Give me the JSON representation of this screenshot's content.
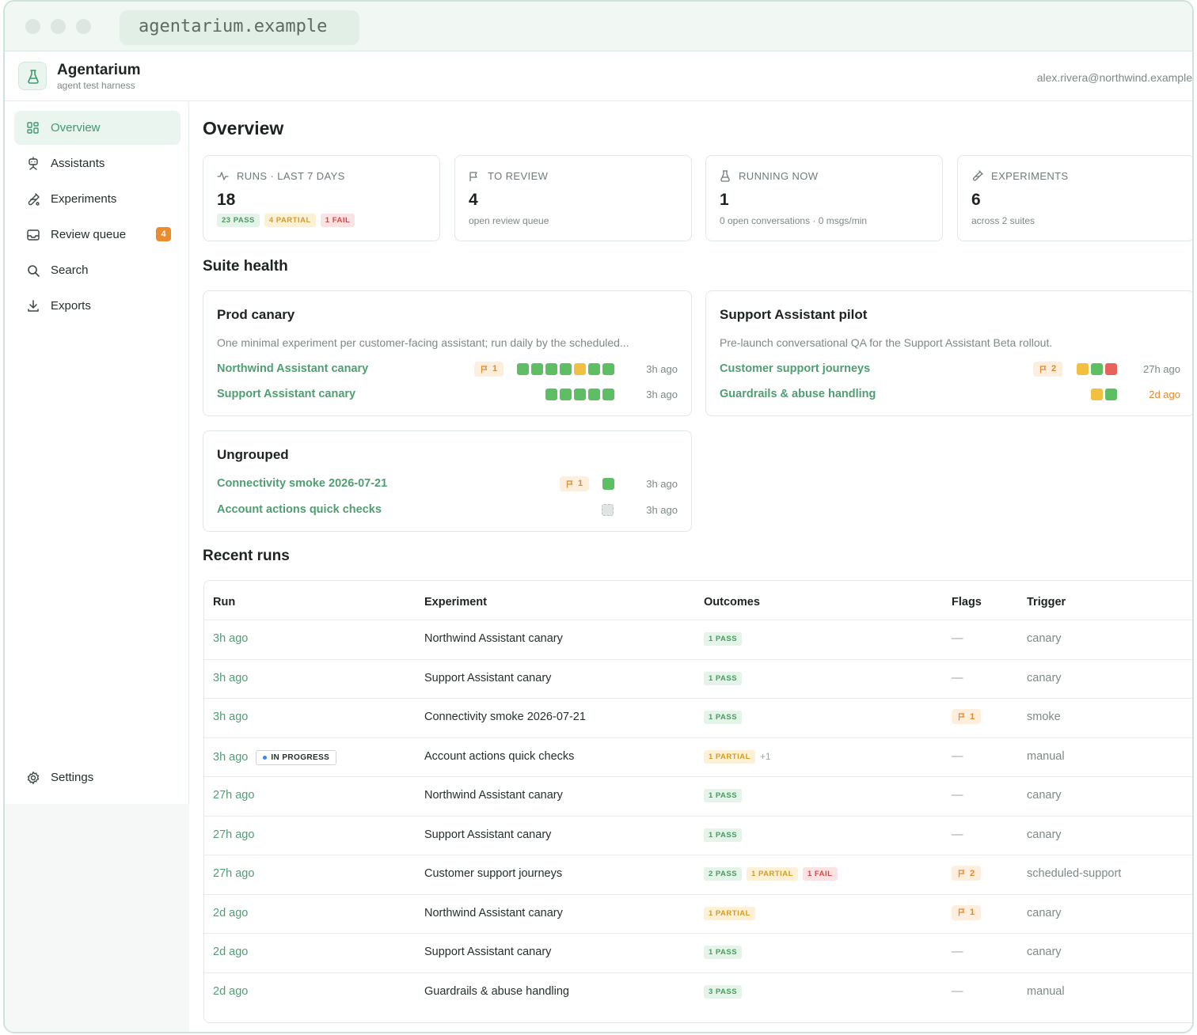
{
  "browser": {
    "url": "agentarium.example"
  },
  "app": {
    "name": "Agentarium",
    "subtitle": "agent test harness",
    "user_email": "alex.rivera@northwind.example"
  },
  "nav": {
    "items": [
      {
        "label": "Overview",
        "icon": "dashboard-icon",
        "active": true
      },
      {
        "label": "Assistants",
        "icon": "robot-icon"
      },
      {
        "label": "Experiments",
        "icon": "flask-icon"
      },
      {
        "label": "Review queue",
        "icon": "inbox-icon",
        "badge": "4"
      },
      {
        "label": "Search",
        "icon": "search-icon"
      },
      {
        "label": "Exports",
        "icon": "download-icon"
      }
    ],
    "settings": {
      "label": "Settings",
      "icon": "gear-icon"
    }
  },
  "page": {
    "title": "Overview"
  },
  "stats": {
    "runs": {
      "label": "RUNS · LAST 7 DAYS",
      "value": "18",
      "pass": "23 PASS",
      "partial": "4 PARTIAL",
      "fail": "1 FAIL"
    },
    "review": {
      "label": "TO REVIEW",
      "value": "4",
      "sub": "open review queue"
    },
    "running": {
      "label": "RUNNING NOW",
      "value": "1",
      "sub": "0 open conversations · 0 msgs/min"
    },
    "experiments": {
      "label": "EXPERIMENTS",
      "value": "6",
      "sub": "across 2 suites"
    }
  },
  "suite_health": {
    "title": "Suite health",
    "suites": [
      {
        "name": "Prod canary",
        "description": "One minimal experiment per customer-facing assistant; run daily by the scheduled...",
        "experiments": [
          {
            "name": "Northwind Assistant canary",
            "flags": "1",
            "outcomes": [
              "pass",
              "pass",
              "pass",
              "pass",
              "partial",
              "pass",
              "pass"
            ],
            "time": "3h ago"
          },
          {
            "name": "Support Assistant canary",
            "flags": null,
            "outcomes": [
              "pass",
              "pass",
              "pass",
              "pass",
              "pass"
            ],
            "time": "3h ago"
          }
        ]
      },
      {
        "name": "Support Assistant pilot",
        "description": "Pre-launch conversational QA for the Support Assistant Beta rollout.",
        "experiments": [
          {
            "name": "Customer support journeys",
            "flags": "2",
            "outcomes": [
              "partial",
              "pass",
              "fail"
            ],
            "time": "27h ago"
          },
          {
            "name": "Guardrails & abuse handling",
            "flags": null,
            "outcomes": [
              "partial",
              "pass"
            ],
            "time": "2d ago",
            "stale": true
          }
        ]
      },
      {
        "name": "Ungrouped",
        "description": "",
        "experiments": [
          {
            "name": "Connectivity smoke 2026-07-21",
            "flags": "1",
            "outcomes": [
              "pass"
            ],
            "time": "3h ago"
          },
          {
            "name": "Account actions quick checks",
            "flags": null,
            "outcomes": [
              "empty"
            ],
            "time": "3h ago"
          }
        ]
      }
    ]
  },
  "recent_runs": {
    "title": "Recent runs",
    "columns": [
      "Run",
      "Experiment",
      "Outcomes",
      "Flags",
      "Trigger"
    ],
    "in_progress_label": "IN PROGRESS",
    "rows": [
      {
        "run": "3h ago",
        "experiment": "Northwind Assistant canary",
        "outcomes": [
          {
            "t": "pass",
            "label": "1 PASS"
          }
        ],
        "flags": "—",
        "trigger": "canary"
      },
      {
        "run": "3h ago",
        "experiment": "Support Assistant canary",
        "outcomes": [
          {
            "t": "pass",
            "label": "1 PASS"
          }
        ],
        "flags": "—",
        "trigger": "canary"
      },
      {
        "run": "3h ago",
        "experiment": "Connectivity smoke 2026-07-21",
        "outcomes": [
          {
            "t": "pass",
            "label": "1 PASS"
          }
        ],
        "flags": "1",
        "trigger": "smoke"
      },
      {
        "run": "3h ago",
        "in_progress": true,
        "experiment": "Account actions quick checks",
        "outcomes": [
          {
            "t": "partial",
            "label": "1 PARTIAL"
          }
        ],
        "extra": "+1",
        "flags": "—",
        "trigger": "manual"
      },
      {
        "run": "27h ago",
        "experiment": "Northwind Assistant canary",
        "outcomes": [
          {
            "t": "pass",
            "label": "1 PASS"
          }
        ],
        "flags": "—",
        "trigger": "canary"
      },
      {
        "run": "27h ago",
        "experiment": "Support Assistant canary",
        "outcomes": [
          {
            "t": "pass",
            "label": "1 PASS"
          }
        ],
        "flags": "—",
        "trigger": "canary"
      },
      {
        "run": "27h ago",
        "experiment": "Customer support journeys",
        "outcomes": [
          {
            "t": "pass",
            "label": "2 PASS"
          },
          {
            "t": "partial",
            "label": "1 PARTIAL"
          },
          {
            "t": "fail",
            "label": "1 FAIL"
          }
        ],
        "flags": "2",
        "trigger": "scheduled-support"
      },
      {
        "run": "2d ago",
        "experiment": "Northwind Assistant canary",
        "outcomes": [
          {
            "t": "partial",
            "label": "1 PARTIAL"
          }
        ],
        "flags": "1",
        "trigger": "canary"
      },
      {
        "run": "2d ago",
        "experiment": "Support Assistant canary",
        "outcomes": [
          {
            "t": "pass",
            "label": "1 PASS"
          }
        ],
        "flags": "—",
        "trigger": "canary"
      },
      {
        "run": "2d ago",
        "experiment": "Guardrails & abuse handling",
        "outcomes": [
          {
            "t": "pass",
            "label": "3 PASS"
          }
        ],
        "flags": "—",
        "trigger": "manual"
      }
    ]
  },
  "colors": {
    "accent": "#4f9e73",
    "pass": "#5ebe64",
    "partial": "#f2c040",
    "fail": "#e7625c",
    "badge": "#ec8a2e"
  }
}
